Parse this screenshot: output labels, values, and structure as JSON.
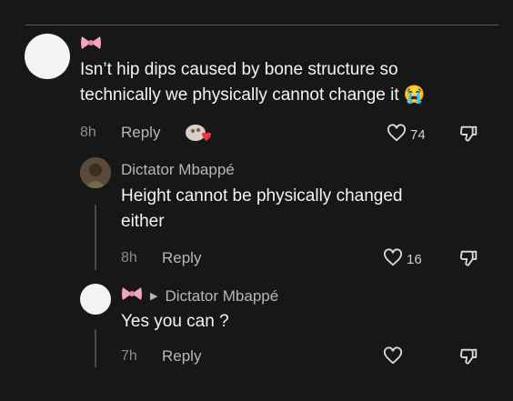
{
  "comments": [
    {
      "username": "",
      "text_lines": [
        "Isn’t hip dips caused by bone structure so",
        "technically we physically cannot change it 😭"
      ],
      "time": "8h",
      "reply_label": "Reply",
      "likes": "74"
    },
    {
      "username": "Dictator Mbappé",
      "text_lines": [
        "Height cannot be physically changed",
        "either"
      ],
      "time": "8h",
      "reply_label": "Reply",
      "likes": "16"
    },
    {
      "username": "",
      "reply_to": "Dictator Mbappé",
      "text_lines": [
        "Yes you can ?"
      ],
      "time": "7h",
      "reply_label": "Reply",
      "likes": ""
    }
  ],
  "colors": {
    "background": "#171717",
    "text": "#f4f4f4",
    "muted": "#8c8c8c",
    "bow": "#f4a6b8"
  },
  "icons": [
    "bow-emoji",
    "heart-outline-icon",
    "thumbs-down-outline-icon",
    "sticker-icon",
    "play-arrow-icon"
  ]
}
